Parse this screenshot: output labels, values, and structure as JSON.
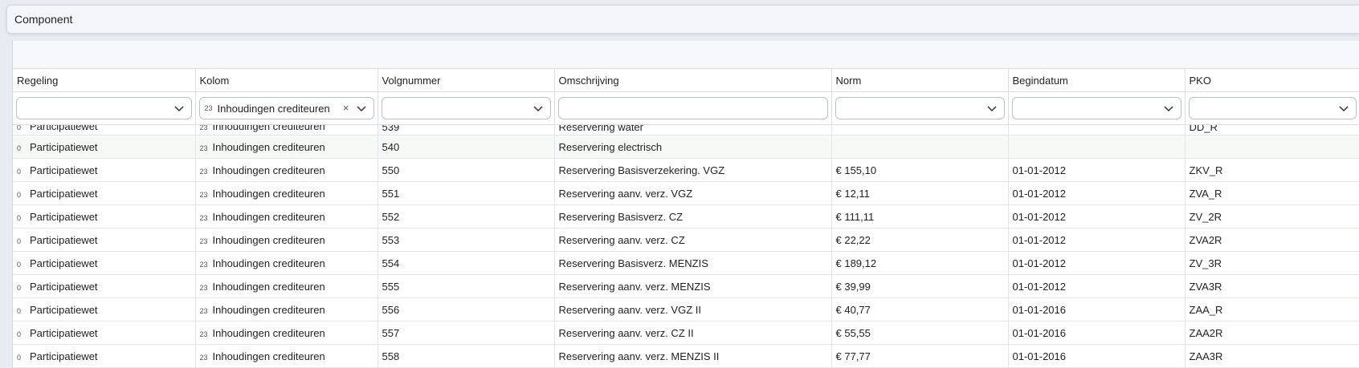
{
  "panel": {
    "title": "Component"
  },
  "columns": [
    "Regeling",
    "Kolom",
    "Volgnummer",
    "Omschrijving",
    "Norm",
    "Begindatum",
    "PKO"
  ],
  "filters": {
    "kolom_badge": "23",
    "kolom_value": "Inhoudingen crediteuren",
    "clear_symbol": "×"
  },
  "rows": [
    {
      "badge1": "0",
      "regeling": "Participatiewet",
      "badge2": "23",
      "kolom": "Inhoudingen crediteuren",
      "volgnummer": "539",
      "omschrijving": "Reservering water",
      "norm": "",
      "begindatum": "",
      "pko": "DD_R"
    },
    {
      "badge1": "0",
      "regeling": "Participatiewet",
      "badge2": "23",
      "kolom": "Inhoudingen crediteuren",
      "volgnummer": "540",
      "omschrijving": "Reservering electrisch",
      "norm": "",
      "begindatum": "",
      "pko": ""
    },
    {
      "badge1": "0",
      "regeling": "Participatiewet",
      "badge2": "23",
      "kolom": "Inhoudingen crediteuren",
      "volgnummer": "550",
      "omschrijving": "Reservering Basisverzekering. VGZ",
      "norm": "€ 155,10",
      "begindatum": "01-01-2012",
      "pko": "ZKV_R"
    },
    {
      "badge1": "0",
      "regeling": "Participatiewet",
      "badge2": "23",
      "kolom": "Inhoudingen crediteuren",
      "volgnummer": "551",
      "omschrijving": "Reservering aanv. verz. VGZ",
      "norm": "€ 12,11",
      "begindatum": "01-01-2012",
      "pko": "ZVA_R"
    },
    {
      "badge1": "0",
      "regeling": "Participatiewet",
      "badge2": "23",
      "kolom": "Inhoudingen crediteuren",
      "volgnummer": "552",
      "omschrijving": "Reservering Basisverz. CZ",
      "norm": "€ 111,11",
      "begindatum": "01-01-2012",
      "pko": "ZV_2R"
    },
    {
      "badge1": "0",
      "regeling": "Participatiewet",
      "badge2": "23",
      "kolom": "Inhoudingen crediteuren",
      "volgnummer": "553",
      "omschrijving": "Reservering aanv. verz. CZ",
      "norm": "€ 22,22",
      "begindatum": "01-01-2012",
      "pko": "ZVA2R"
    },
    {
      "badge1": "0",
      "regeling": "Participatiewet",
      "badge2": "23",
      "kolom": "Inhoudingen crediteuren",
      "volgnummer": "554",
      "omschrijving": "Reservering Basisverz. MENZIS",
      "norm": "€ 189,12",
      "begindatum": "01-01-2012",
      "pko": "ZV_3R"
    },
    {
      "badge1": "0",
      "regeling": "Participatiewet",
      "badge2": "23",
      "kolom": "Inhoudingen crediteuren",
      "volgnummer": "555",
      "omschrijving": "Reservering aanv. verz. MENZIS",
      "norm": "€ 39,99",
      "begindatum": "01-01-2012",
      "pko": "ZVA3R"
    },
    {
      "badge1": "0",
      "regeling": "Participatiewet",
      "badge2": "23",
      "kolom": "Inhoudingen crediteuren",
      "volgnummer": "556",
      "omschrijving": "Reservering aanv. verz. VGZ II",
      "norm": "€ 40,77",
      "begindatum": "01-01-2016",
      "pko": "ZAA_R"
    },
    {
      "badge1": "0",
      "regeling": "Participatiewet",
      "badge2": "23",
      "kolom": "Inhoudingen crediteuren",
      "volgnummer": "557",
      "omschrijving": "Reservering aanv. verz. CZ II",
      "norm": "€ 55,55",
      "begindatum": "01-01-2016",
      "pko": "ZAA2R"
    },
    {
      "badge1": "0",
      "regeling": "Participatiewet",
      "badge2": "23",
      "kolom": "Inhoudingen crediteuren",
      "volgnummer": "558",
      "omschrijving": "Reservering aanv. verz. MENZIS II",
      "norm": "€ 77,77",
      "begindatum": "01-01-2016",
      "pko": "ZAA3R"
    }
  ]
}
